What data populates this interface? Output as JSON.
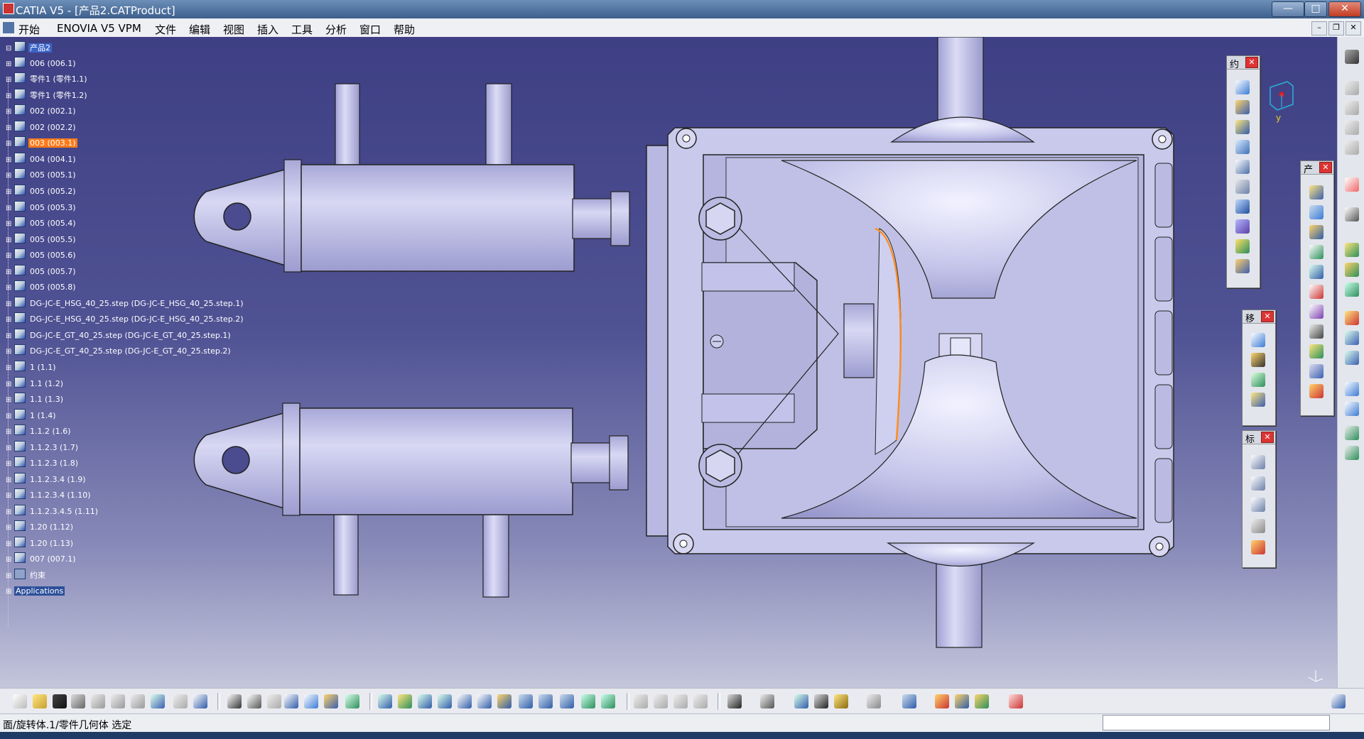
{
  "window": {
    "title": "CATIA V5 - [产品2.CATProduct]",
    "buttons": {
      "minimize": "—",
      "maximize": "□",
      "close": "✕"
    }
  },
  "menubar": {
    "items": [
      "开始",
      "ENOVIA V5 VPM",
      "文件",
      "编辑",
      "视图",
      "插入",
      "工具",
      "分析",
      "窗口",
      "帮助"
    ],
    "mdi": {
      "minimize": "–",
      "restore": "❐",
      "close": "✕"
    }
  },
  "tree": {
    "nodes": [
      {
        "label": "产品2",
        "kind": "root"
      },
      {
        "label": "006 (006.1)"
      },
      {
        "label": "零件1 (零件1.1)"
      },
      {
        "label": "零件1 (零件1.2)"
      },
      {
        "label": "002 (002.1)"
      },
      {
        "label": "002 (002.2)"
      },
      {
        "label": "003 (003.1)",
        "selected": true
      },
      {
        "label": "004 (004.1)"
      },
      {
        "label": "005 (005.1)"
      },
      {
        "label": "005 (005.2)"
      },
      {
        "label": "005 (005.3)"
      },
      {
        "label": "005 (005.4)"
      },
      {
        "label": "005 (005.5)"
      },
      {
        "label": "005 (005.6)"
      },
      {
        "label": "005 (005.7)"
      },
      {
        "label": "005 (005.8)"
      },
      {
        "label": "DG-JC-E_HSG_40_25.step (DG-JC-E_HSG_40_25.step.1)"
      },
      {
        "label": "DG-JC-E_HSG_40_25.step (DG-JC-E_HSG_40_25.step.2)"
      },
      {
        "label": "DG-JC-E_GT_40_25.step (DG-JC-E_GT_40_25.step.1)"
      },
      {
        "label": "DG-JC-E_GT_40_25.step (DG-JC-E_GT_40_25.step.2)"
      },
      {
        "label": "1 (1.1)"
      },
      {
        "label": "1.1 (1.2)"
      },
      {
        "label": "1.1 (1.3)"
      },
      {
        "label": "1 (1.4)"
      },
      {
        "label": "1.1.2 (1.6)"
      },
      {
        "label": "1.1.2.3 (1.7)"
      },
      {
        "label": "1.1.2.3 (1.8)"
      },
      {
        "label": "1.1.2.3.4 (1.9)"
      },
      {
        "label": "1.1.2.3.4 (1.10)"
      },
      {
        "label": "1.1.2.3.4.5 (1.11)"
      },
      {
        "label": "1.20 (1.12)"
      },
      {
        "label": "1.20 (1.13)"
      },
      {
        "label": "007 (007.1)"
      },
      {
        "label": "约束",
        "kind": "constraints"
      },
      {
        "label": "Applications",
        "kind": "apps"
      }
    ]
  },
  "toolbars": {
    "constraints": {
      "title": "约"
    },
    "product": {
      "title": "产"
    },
    "move": {
      "title": "移"
    },
    "annotation": {
      "title": "标"
    },
    "close_glyph": "✕"
  },
  "compass_axis": "y",
  "statusbar": {
    "message": "面/旋转体.1/零件几何体 选定",
    "input_value": ""
  },
  "colors": {
    "selected_highlight": "#ff7a1a",
    "part_body": "#c9c9ec",
    "edge_highlight": "#ff8c1a"
  }
}
